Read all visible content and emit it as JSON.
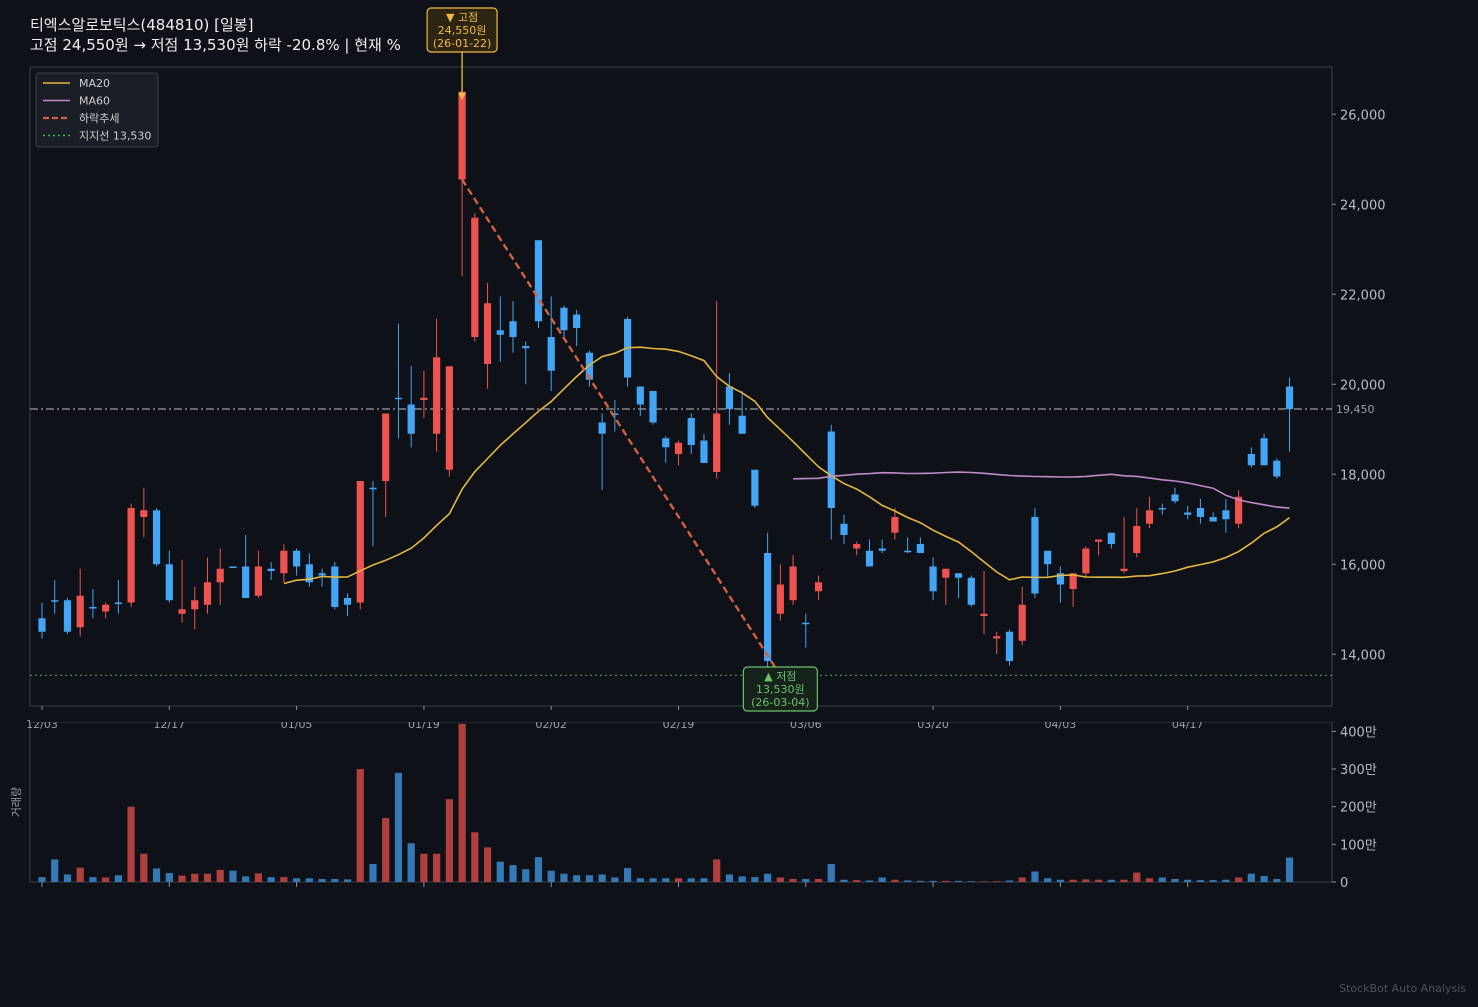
{
  "title": {
    "line1": "티엑스알로보틱스(484810)  [일봉]",
    "line2": "고점 24,550원 → 저점 13,530원  하락 -20.8%  |  현재 %"
  },
  "watermark": "StockBot Auto Analysis",
  "colors": {
    "background": "#0e1117",
    "up": "#ef5350",
    "down": "#42a5f5",
    "ma20": "#e6b73e",
    "ma60": "#c28ac7",
    "trend": "#d4603f",
    "support": "#4caf50",
    "current": "#9e9e9e",
    "peak_box": "#f4b942",
    "trough_box": "#6cc070"
  },
  "chart_data": [
    {
      "type": "candlestick",
      "ylim": [
        12850,
        27050
      ],
      "yticks": [
        14000,
        16000,
        18000,
        20000,
        22000,
        24000,
        26000
      ],
      "ytick_labels": [
        "14,000",
        "16,000",
        "18,000",
        "20,000",
        "22,000",
        "24,000",
        "26,000"
      ],
      "xtick_labels": [
        "12/03",
        "12/17",
        "01/05",
        "01/19",
        "02/02",
        "02/19",
        "03/06",
        "03/20",
        "04/03",
        "04/17"
      ],
      "xtick_index": [
        0,
        10,
        20,
        30,
        40,
        50,
        60,
        70,
        80,
        90
      ],
      "legend": [
        "MA20",
        "MA60",
        "하락추세",
        "지지선 13,530"
      ],
      "current_price": 19450,
      "current_label": "19,450",
      "support": 13530,
      "trend": {
        "from_index": 33,
        "from_price": 24550,
        "to_index": 58,
        "to_price": 13530
      },
      "peak": {
        "index": 33,
        "price": 24550,
        "label1": "▼ 고점",
        "label2": "24,550원",
        "label3": "(26-01-22)"
      },
      "trough": {
        "index": 58,
        "price": 13530,
        "label1": "▲ 저점",
        "label2": "13,530원",
        "label3": "(26-03-04)"
      },
      "ohlc": [
        [
          14800,
          15150,
          14350,
          14500
        ],
        [
          15200,
          15650,
          14900,
          15200
        ],
        [
          15200,
          15250,
          14450,
          14500
        ],
        [
          14600,
          15900,
          14400,
          15300
        ],
        [
          15050,
          15450,
          14800,
          15050
        ],
        [
          14950,
          15150,
          14800,
          15100
        ],
        [
          15150,
          15650,
          14900,
          15150
        ],
        [
          15150,
          17350,
          15050,
          17250
        ],
        [
          17050,
          17700,
          16600,
          17200
        ],
        [
          17200,
          17250,
          15950,
          16000
        ],
        [
          16000,
          16300,
          15150,
          15200
        ],
        [
          14900,
          16100,
          14700,
          15000
        ],
        [
          15000,
          15500,
          14550,
          15200
        ],
        [
          15100,
          16150,
          14900,
          15600
        ],
        [
          15600,
          16350,
          15100,
          15900
        ],
        [
          15950,
          15950,
          15950,
          15950
        ],
        [
          15950,
          16650,
          15250,
          15250
        ],
        [
          15300,
          16300,
          15250,
          15950
        ],
        [
          15900,
          16050,
          15650,
          15850
        ],
        [
          15800,
          16450,
          15600,
          16300
        ],
        [
          16300,
          16350,
          15750,
          15950
        ],
        [
          16000,
          16250,
          15500,
          15600
        ],
        [
          15800,
          15900,
          15500,
          15750
        ],
        [
          15950,
          16050,
          15000,
          15050
        ],
        [
          15250,
          15350,
          14850,
          15100
        ],
        [
          15150,
          16950,
          15000,
          17850
        ],
        [
          17700,
          17850,
          16400,
          17700
        ],
        [
          17850,
          18750,
          17050,
          19350
        ],
        [
          19700,
          21350,
          18800,
          19700
        ],
        [
          19550,
          20400,
          18600,
          18900
        ],
        [
          19650,
          20300,
          19250,
          19700
        ],
        [
          18900,
          21450,
          18500,
          20600
        ],
        [
          18100,
          20400,
          17950,
          20400
        ],
        [
          24550,
          25950,
          22400,
          26500
        ],
        [
          21050,
          23800,
          20950,
          23700
        ],
        [
          20450,
          22250,
          19900,
          21800
        ],
        [
          21200,
          21950,
          20500,
          21100
        ],
        [
          21400,
          21850,
          20700,
          21050
        ],
        [
          20850,
          20950,
          20000,
          20800
        ],
        [
          23200,
          23200,
          21250,
          21400
        ],
        [
          21050,
          21950,
          19850,
          20300
        ],
        [
          21700,
          21750,
          21050,
          21200
        ],
        [
          21550,
          21650,
          20850,
          21250
        ],
        [
          20700,
          20750,
          19950,
          20100
        ],
        [
          19150,
          19350,
          17650,
          18900
        ],
        [
          19350,
          19650,
          18950,
          19350
        ],
        [
          21450,
          21500,
          19950,
          20150
        ],
        [
          19950,
          19950,
          19300,
          19550
        ],
        [
          19850,
          19800,
          19100,
          19150
        ],
        [
          18800,
          18850,
          18250,
          18600
        ],
        [
          18450,
          18750,
          18200,
          18700
        ],
        [
          19250,
          19350,
          18450,
          18650
        ],
        [
          18750,
          18900,
          18250,
          18250
        ],
        [
          18050,
          21850,
          17900,
          19350
        ],
        [
          19950,
          20250,
          19100,
          19450
        ],
        [
          19300,
          19850,
          18900,
          18900
        ],
        [
          18100,
          18100,
          17250,
          17300
        ],
        [
          16250,
          16700,
          13650,
          13850
        ],
        [
          14900,
          16000,
          14750,
          15550
        ],
        [
          15200,
          16200,
          15100,
          15950
        ],
        [
          14700,
          14900,
          14150,
          14700
        ],
        [
          15400,
          15750,
          15200,
          15600
        ],
        [
          18950,
          19100,
          16550,
          17250
        ],
        [
          16900,
          17100,
          16450,
          16650
        ],
        [
          16350,
          16500,
          16200,
          16450
        ],
        [
          16300,
          16550,
          16100,
          15950
        ],
        [
          16350,
          16550,
          16250,
          16300
        ],
        [
          16700,
          17250,
          16550,
          17050
        ],
        [
          16300,
          16600,
          16250,
          16300
        ],
        [
          16450,
          16600,
          16250,
          16250
        ],
        [
          15950,
          16150,
          15200,
          15400
        ],
        [
          15700,
          15900,
          15100,
          15900
        ],
        [
          15800,
          15800,
          15250,
          15700
        ],
        [
          15700,
          15750,
          15050,
          15100
        ],
        [
          14850,
          15850,
          14450,
          14900
        ],
        [
          14350,
          14500,
          14000,
          14400
        ],
        [
          14500,
          14550,
          13750,
          13850
        ],
        [
          14300,
          15500,
          14200,
          15100
        ],
        [
          17050,
          17250,
          15250,
          15350
        ],
        [
          16300,
          16250,
          15700,
          16000
        ],
        [
          15800,
          15950,
          15150,
          15550
        ],
        [
          15450,
          15550,
          15050,
          15800
        ],
        [
          15800,
          16400,
          15700,
          16350
        ],
        [
          16500,
          16550,
          16200,
          16550
        ],
        [
          16700,
          16700,
          16350,
          16450
        ],
        [
          15850,
          17050,
          15800,
          15900
        ],
        [
          16250,
          17250,
          16150,
          16850
        ],
        [
          16900,
          17500,
          16800,
          17200
        ],
        [
          17250,
          17350,
          17100,
          17250
        ],
        [
          17550,
          17700,
          17350,
          17400
        ],
        [
          17150,
          17300,
          17000,
          17100
        ],
        [
          17250,
          17450,
          16900,
          17050
        ],
        [
          17050,
          17150,
          16950,
          16950
        ],
        [
          17200,
          17450,
          16700,
          17000
        ],
        [
          16900,
          17650,
          16800,
          17500
        ],
        [
          18450,
          18600,
          18150,
          18200
        ],
        [
          18800,
          18900,
          18200,
          18200
        ],
        [
          18300,
          18350,
          17900,
          17950
        ],
        [
          19950,
          20150,
          18500,
          19450
        ]
      ],
      "volume": [
        13,
        60,
        20,
        38,
        13,
        12,
        18,
        200,
        75,
        36,
        24,
        17,
        22,
        22,
        32,
        30,
        15,
        23,
        13,
        13,
        10,
        10,
        8,
        8,
        7,
        300,
        48,
        170,
        290,
        103,
        75,
        75,
        220,
        420,
        132,
        92,
        54,
        45,
        34,
        66,
        30,
        22,
        18,
        18,
        20,
        12,
        37,
        10,
        10,
        10,
        10,
        10,
        10,
        60,
        20,
        15,
        13,
        22,
        12,
        8,
        8,
        8,
        48,
        6,
        5,
        4,
        12,
        6,
        4,
        3,
        3,
        3,
        3,
        2,
        2,
        2,
        4,
        12,
        28,
        10,
        6,
        6,
        7,
        6,
        6,
        6,
        25,
        10,
        12,
        8,
        6,
        5,
        5,
        6,
        12,
        22,
        16,
        8,
        65
      ],
      "volume_yticks": [
        0,
        100,
        200,
        300,
        400
      ],
      "volume_ytick_labels": [
        "0",
        "100만",
        "200만",
        "300만",
        "400만"
      ],
      "volume_ylabel": "거래량",
      "volume_ylim": [
        0,
        425
      ]
    }
  ]
}
